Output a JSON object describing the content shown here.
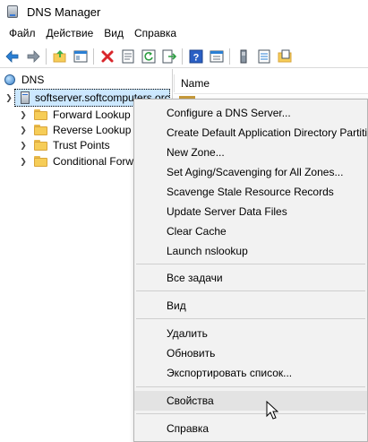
{
  "window": {
    "title": "DNS Manager",
    "icon": "dns-manager-icon"
  },
  "menubar": {
    "items": [
      "Файл",
      "Действие",
      "Вид",
      "Справка"
    ]
  },
  "toolbar": {
    "buttons": [
      "back-arrow-icon",
      "forward-arrow-icon",
      "up-folder-icon",
      "show-hide-tree-icon",
      "delete-icon",
      "properties-icon",
      "refresh-icon",
      "export-icon",
      "help-icon",
      "mmc-view-icon",
      "server-icon",
      "record-icon",
      "zone-icon"
    ]
  },
  "tree": {
    "root": "DNS",
    "server": "softserver.softcomputers.orc",
    "children": [
      "Forward Lookup",
      "Reverse Lookup Z",
      "Trust Points",
      "Conditional Forw"
    ]
  },
  "list": {
    "column_name": "Name"
  },
  "context_menu": {
    "items": [
      "Configure a DNS Server...",
      "Create Default Application Directory Partiti",
      "New Zone...",
      "Set Aging/Scavenging for All Zones...",
      "Scavenge Stale Resource Records",
      "Update Server Data Files",
      "Clear Cache",
      "Launch nslookup",
      "Все задачи",
      "Вид",
      "Удалить",
      "Обновить",
      "Экспортировать список...",
      "Свойства",
      "Справка"
    ],
    "hovered": "Свойства"
  },
  "colors": {
    "selection": "#cce8ff",
    "menu_bg": "#f2f2f2",
    "hover_bg": "#e3e3e3",
    "folder": "#f6cd58"
  }
}
